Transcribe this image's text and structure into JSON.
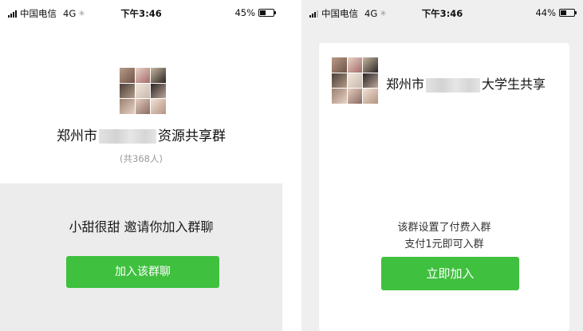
{
  "left": {
    "status": {
      "carrier": "中国电信",
      "network": "4G",
      "loading": "✳",
      "time": "下午3:46",
      "battery": "45%",
      "battery_level": 0.45
    },
    "group": {
      "title_prefix": "郑州市",
      "title_suffix": "资源共享群",
      "member_count": "(共368人)"
    },
    "invite": {
      "text": "小甜很甜 邀请你加入群聊",
      "join_label": "加入该群聊"
    }
  },
  "right": {
    "status": {
      "carrier": "中国电信",
      "network": "4G",
      "loading": "✳",
      "time": "下午3:46",
      "battery": "44%",
      "battery_level": 0.44
    },
    "group": {
      "title_prefix": "郑州市",
      "title_suffix": "大学生共享"
    },
    "notice": {
      "line1": "该群设置了付费入群",
      "line2": "支付1元即可入群"
    },
    "join_label": "立即加入"
  },
  "colors": {
    "accent_green": "#3fc03f",
    "panel_gray": "#ececec",
    "background_gray": "#efefef"
  },
  "icons": {
    "signal": "signal-bars-icon",
    "battery": "battery-icon",
    "group_avatar": "group-avatar-mosaic"
  }
}
